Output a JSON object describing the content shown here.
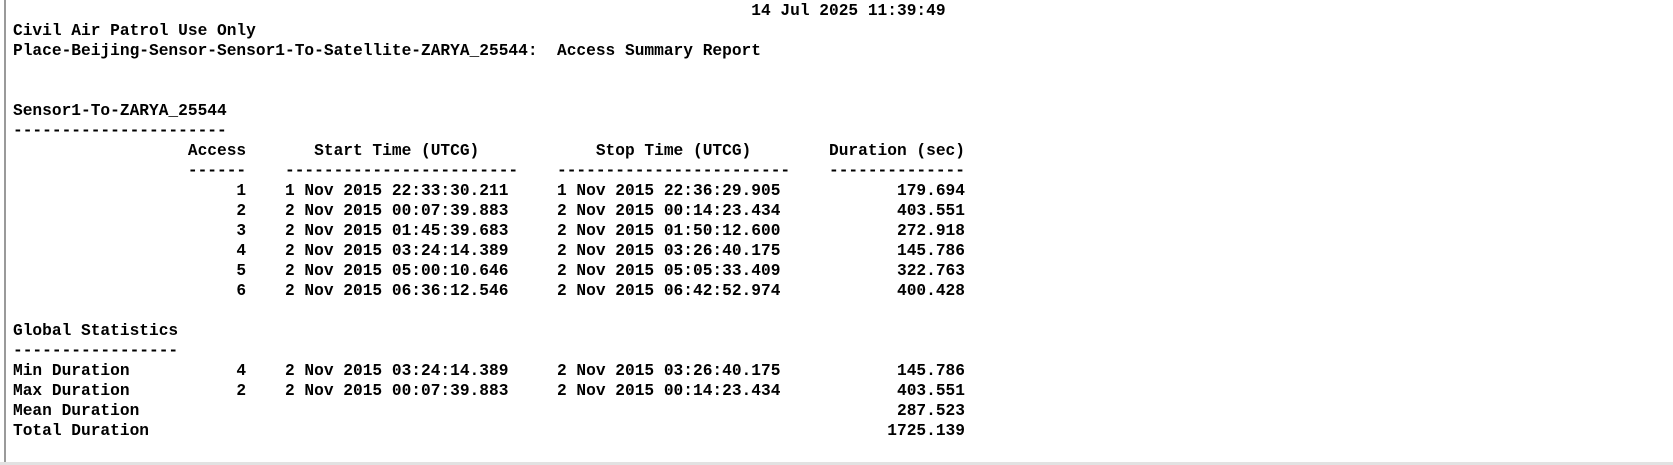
{
  "report": {
    "timestamp": "14 Jul 2025 11:39:49",
    "classification": "Civil Air Patrol Use Only",
    "title": "Place-Beijing-Sensor-Sensor1-To-Satellite-ZARYA_25544:  Access Summary Report",
    "section_title": "Sensor1-To-ZARYA_25544",
    "section_rule": "----------------------",
    "columns": [
      "Access",
      "Start Time (UTCG)",
      "Stop Time (UTCG)",
      "Duration (sec)"
    ],
    "column_rules": [
      "------",
      "------------------------",
      "------------------------",
      "--------------"
    ],
    "rows": [
      {
        "access": "1",
        "start": "1 Nov 2015 22:33:30.211",
        "stop": "1 Nov 2015 22:36:29.905",
        "duration": "179.694"
      },
      {
        "access": "2",
        "start": "2 Nov 2015 00:07:39.883",
        "stop": "2 Nov 2015 00:14:23.434",
        "duration": "403.551"
      },
      {
        "access": "3",
        "start": "2 Nov 2015 01:45:39.683",
        "stop": "2 Nov 2015 01:50:12.600",
        "duration": "272.918"
      },
      {
        "access": "4",
        "start": "2 Nov 2015 03:24:14.389",
        "stop": "2 Nov 2015 03:26:40.175",
        "duration": "145.786"
      },
      {
        "access": "5",
        "start": "2 Nov 2015 05:00:10.646",
        "stop": "2 Nov 2015 05:05:33.409",
        "duration": "322.763"
      },
      {
        "access": "6",
        "start": "2 Nov 2015 06:36:12.546",
        "stop": "2 Nov 2015 06:42:52.974",
        "duration": "400.428"
      }
    ],
    "global_title": "Global Statistics",
    "global_rule": "-----------------",
    "global_stats": [
      {
        "label": "Min Duration",
        "access": "4",
        "start": "2 Nov 2015 03:24:14.389",
        "stop": "2 Nov 2015 03:26:40.175",
        "duration": "145.786"
      },
      {
        "label": "Max Duration",
        "access": "2",
        "start": "2 Nov 2015 00:07:39.883",
        "stop": "2 Nov 2015 00:14:23.434",
        "duration": "403.551"
      },
      {
        "label": "Mean Duration",
        "access": "",
        "start": "",
        "stop": "",
        "duration": "287.523"
      },
      {
        "label": "Total Duration",
        "access": "",
        "start": "",
        "stop": "",
        "duration": "1725.139"
      }
    ]
  }
}
